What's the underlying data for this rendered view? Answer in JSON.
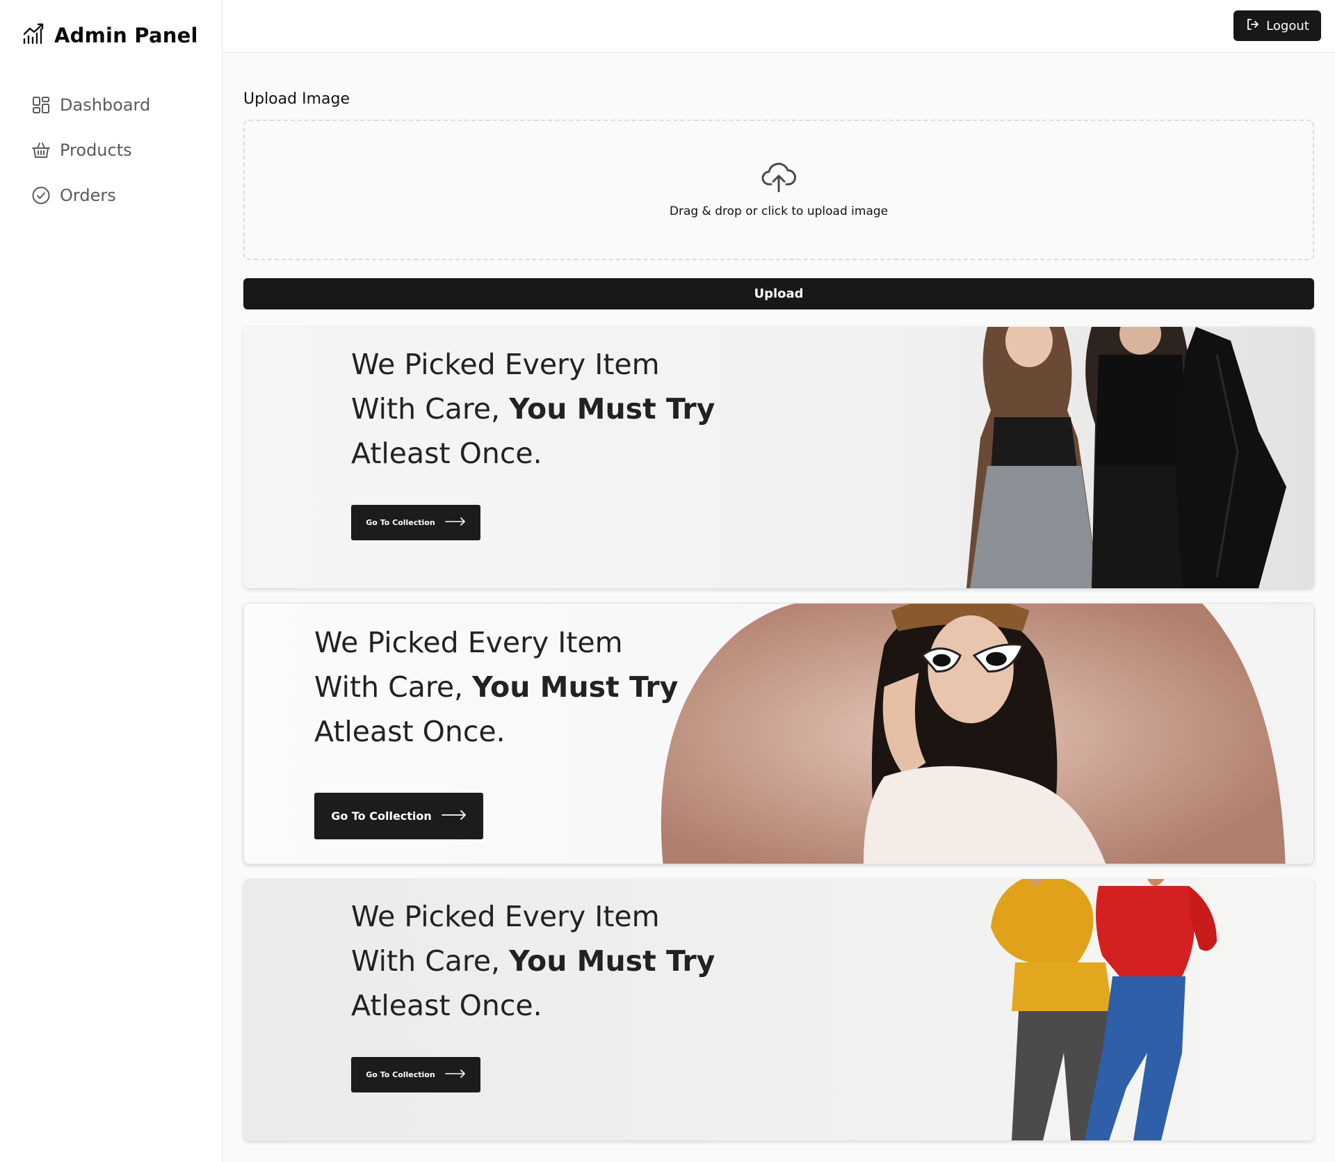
{
  "sidebar": {
    "brand": {
      "title": "Admin Panel",
      "icon": "chart-line-icon"
    },
    "items": [
      {
        "label": "Dashboard",
        "icon": "grid-icon"
      },
      {
        "label": "Products",
        "icon": "basket-icon"
      },
      {
        "label": "Orders",
        "icon": "check-circle-icon"
      }
    ]
  },
  "header": {
    "logout_label": "Logout",
    "logout_icon": "logout-icon"
  },
  "upload": {
    "label": "Upload Image",
    "dropzone_text": "Drag & drop or click to upload image",
    "dropzone_icon": "cloud-upload-icon",
    "button_label": "Upload"
  },
  "banners": [
    {
      "line1": "We Picked Every Item",
      "line2_normal": "With Care, ",
      "line2_bold": "You Must Try",
      "line3": "Atleast Once.",
      "cta": "Go To Collection",
      "image": "three women in black outfits"
    },
    {
      "line1": "We Picked Every Item",
      "line2_normal": "With Care, ",
      "line2_bold": "You Must Try",
      "line3": "Atleast Once.",
      "cta": "Go To Collection",
      "image": "woman with sunglasses and hat"
    },
    {
      "line1": "We Picked Every Item",
      "line2_normal": "With Care, ",
      "line2_bold": "You Must Try",
      "line3": "Atleast Once.",
      "cta": "Go To Collection",
      "image": "two women in sweaters and jeans"
    }
  ],
  "colors": {
    "primary": "#18181b",
    "accent_brown": "#b08070",
    "yellow": "#e0a21a",
    "red": "#d42020",
    "denim": "#2f5fa8"
  }
}
